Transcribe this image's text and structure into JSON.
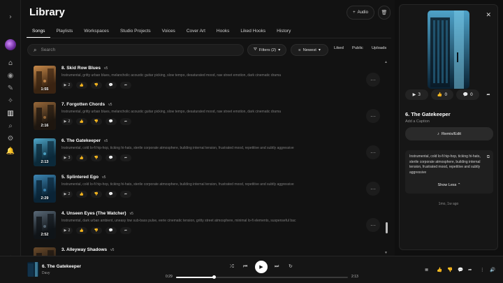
{
  "page": {
    "title": "Library"
  },
  "header": {
    "audio_label": "Audio",
    "audio_icon": "+",
    "trash_icon": "🗑"
  },
  "tabs": [
    "Songs",
    "Playlists",
    "Workspaces",
    "Studio Projects",
    "Voices",
    "Cover Art",
    "Hooks",
    "Liked Hooks",
    "History"
  ],
  "search": {
    "placeholder": "Search",
    "icon": "⌕"
  },
  "filters": {
    "label": "Filters (2)",
    "icon": "⛛",
    "caret": "▾"
  },
  "sort": {
    "label": "Newest",
    "icon": "≡",
    "caret": "▾"
  },
  "segments": [
    "Liked",
    "Public",
    "Uploads"
  ],
  "songs": [
    {
      "title": "8. Skid Row Blues",
      "version": "v5",
      "duration": "1:55",
      "desc": "Instrumental, gritty urban blues, melancholic acoustic guitar picking, slow tempo, desaturated mood, raw street emotion, dark cinematic drama",
      "play_count": "2",
      "thumb_colors": [
        "#3a2412",
        "#c88a4a"
      ]
    },
    {
      "title": "7. Forgotten Chords",
      "version": "v5",
      "duration": "2:16",
      "desc": "Instrumental, gritty urban blues, melancholic acoustic guitar picking, slow tempo, desaturated mood, raw street emotion, dark cinematic drama",
      "play_count": "2",
      "thumb_colors": [
        "#1e1710",
        "#9a6a3a"
      ]
    },
    {
      "title": "6. The Gatekeeper",
      "version": "v5",
      "duration": "2:13",
      "desc": "Instrumental, cold lo-fi hip-hop, ticking hi-hats, sterile corporate atmosphere, building internal tension, frustrated mood, repetitive and subtly aggressive",
      "play_count": "3",
      "thumb_colors": [
        "#0c2a3a",
        "#4fa7c9"
      ]
    },
    {
      "title": "5. Splintered Ego",
      "version": "v5",
      "duration": "2:29",
      "desc": "Instrumental, cold lo-fi hip-hop, ticking hi-hats, sterile corporate atmosphere, building internal tension, frustrated mood, repetitive and subtly aggressive",
      "play_count": "2",
      "thumb_colors": [
        "#0a2436",
        "#3d87b5"
      ]
    },
    {
      "title": "4. Unseen Eyes (The Watcher)",
      "version": "v5",
      "duration": "2:52",
      "desc": "Instrumental, dark urban ambient, uneasy low sub-bass pulse, eerie cinematic tension, gritty street atmosphere, minimal lo-fi elements, suspenseful bac",
      "play_count": "2",
      "thumb_colors": [
        "#101418",
        "#5a6a78"
      ]
    },
    {
      "title": "3. Alleyway Shadows",
      "version": "v5",
      "duration": "",
      "desc": "",
      "play_count": "",
      "thumb_colors": [
        "#1a1410",
        "#6a4a2a"
      ]
    }
  ],
  "row_actions": {
    "play_icon": "▶",
    "like_icon": "👍",
    "dislike_icon": "👎",
    "comment_icon": "💬",
    "share_icon": "➦",
    "more_icon": "···"
  },
  "panel": {
    "title": "6. The Gatekeeper",
    "caption": "Add a Caption",
    "stats": [
      {
        "icon": "▶",
        "value": "3"
      },
      {
        "icon": "👍",
        "value": "0"
      },
      {
        "icon": "💬",
        "value": "0"
      }
    ],
    "share_icon": "➦",
    "remix_label": "Remix/Edit",
    "remix_icon": "♪",
    "description": "Instrumental, cold lo-fi hip-hop, ticking hi-hats, sterile corporate atmosphere, building internal tension, frustrated mood, repetitive and subtly aggressive",
    "show_less": "Show Less",
    "show_less_icon": "⌃",
    "copy_icon": "⧉",
    "close_icon": "✕",
    "posted": "1mo, 1w ago",
    "cover_colors": [
      "#0a2234",
      "#4ea2c8"
    ]
  },
  "player": {
    "title": "6. The Gatekeeper",
    "artist": "Davy",
    "elapsed": "0:29",
    "total": "2:13",
    "progress": 0.22,
    "icons": {
      "shuffle": "⤮",
      "prev": "⏮",
      "play": "▶",
      "next": "⏭",
      "repeat": "↻",
      "queue": "≣",
      "like": "👍",
      "dislike": "👎",
      "comment": "💬",
      "share": "➦",
      "more": "⋮",
      "volume": "🔊"
    }
  },
  "rail": {
    "expand": "›",
    "home": "⌂",
    "explore": "◉",
    "create": "✎",
    "radio": "✧",
    "library": "▥",
    "search": "⌕",
    "settings": "⚙",
    "notifications": "🔔",
    "help": "⚠",
    "more": "···"
  }
}
